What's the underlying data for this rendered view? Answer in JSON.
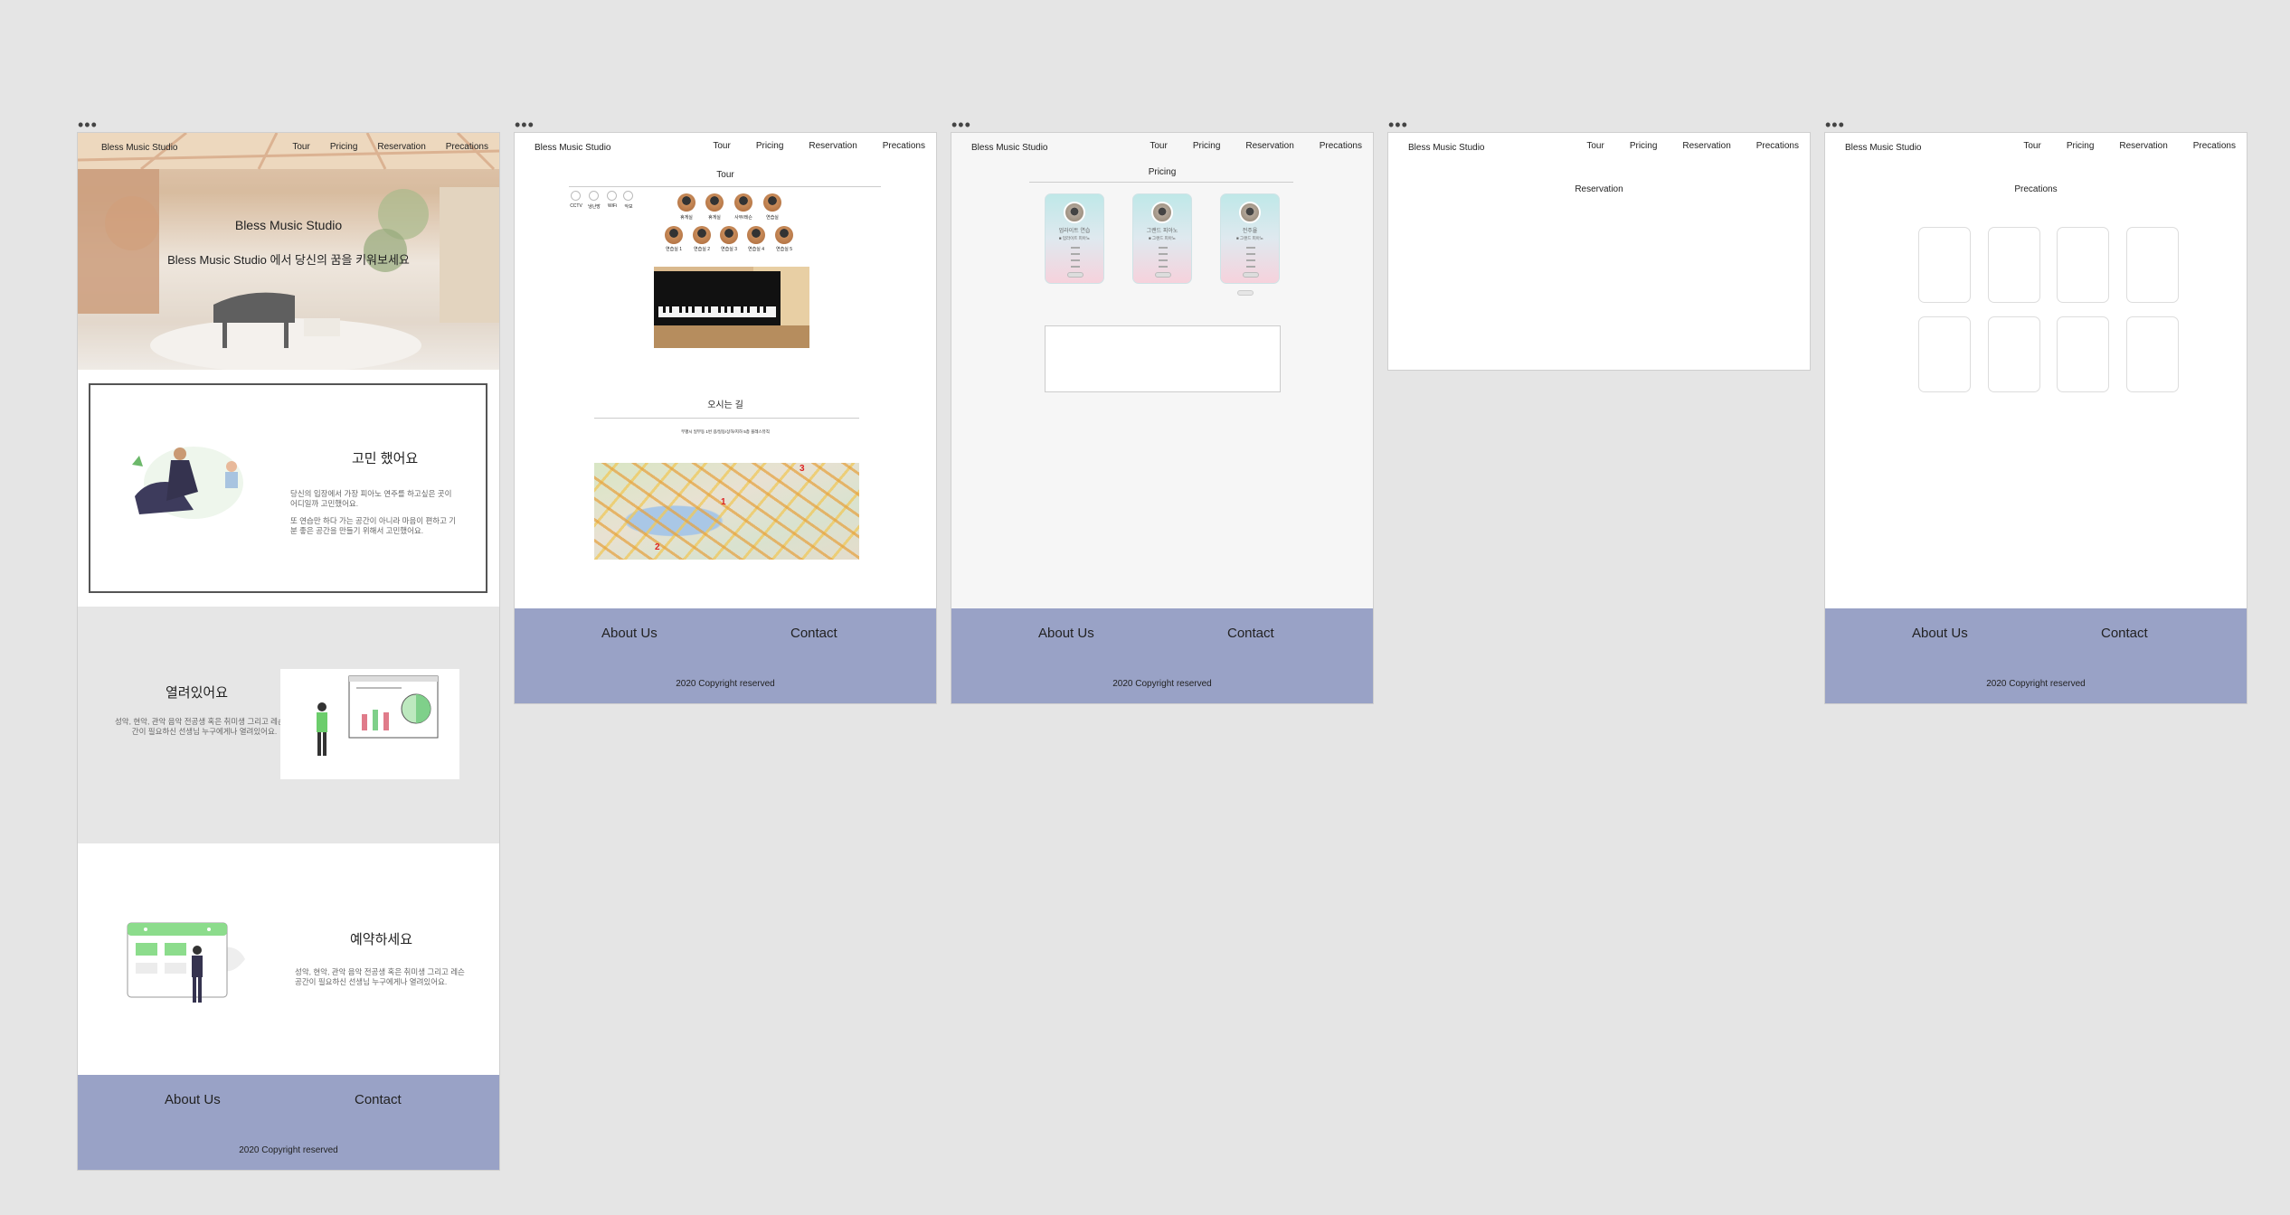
{
  "nav": {
    "brand": "Bless Music Studio",
    "links": [
      "Tour",
      "Pricing",
      "Reservation",
      "Precations"
    ]
  },
  "footer": {
    "about": "About Us",
    "contact": "Contact",
    "copyright": "2020 Copyright reserved"
  },
  "home": {
    "hero_title": "Bless Music Studio",
    "hero_subtitle": "Bless Music Studio 에서 당신의 꿈을 키워보세요",
    "section1": {
      "title": "고민 했어요",
      "text1": "당신의 입장에서 가장 피아노 연주를 하고싶은 곳이 어디일까 고민했어요.",
      "text2": "또 연습만 하다 가는 공간이 아니라 마음이 편하고 기분 좋은 공간을 만들기 위해서 고민했어요."
    },
    "section2": {
      "title": "열려있어요",
      "text": "성악, 현악, 관악 음악 전공생 혹은 취미생 그리고 레슨 공간이 필요하신 선생님 누구에게나 열려있어요."
    },
    "section3": {
      "title": "예약하세요",
      "text": "성악, 현악, 관악 음악 전공생 혹은 취미생 그리고 레슨 공간이 필요하신 선생님 누구에게나 열려있어요."
    }
  },
  "tour": {
    "title": "Tour",
    "amenities": [
      "CCTV",
      "냉난방",
      "WiFi",
      "악보"
    ],
    "rooms_row1": [
      "휴게실",
      "휴게실",
      "사무/레슨",
      "연습실"
    ],
    "rooms_row2": [
      "연습실 1",
      "연습실 2",
      "연습실 3",
      "연습실 4",
      "연습실 5"
    ],
    "directions_title": "오시는 길",
    "directions_text": "부평시 일부동 1번 길/일동/상하/지하 5층 블레스뮤직",
    "map_markers": [
      "1",
      "2",
      "3"
    ]
  },
  "pricing": {
    "title": "Pricing",
    "cards": [
      {
        "name": "업라이트 연습",
        "sub": "■ 업라이트 피아노"
      },
      {
        "name": "그랜드 피아노",
        "sub": "■ 그랜드 피아노"
      },
      {
        "name": "전주율",
        "sub": "■ 그랜드 피아노"
      }
    ]
  },
  "reservation": {
    "title": "Reservation"
  },
  "precations": {
    "title": "Precations"
  },
  "frame_handle": "•••"
}
